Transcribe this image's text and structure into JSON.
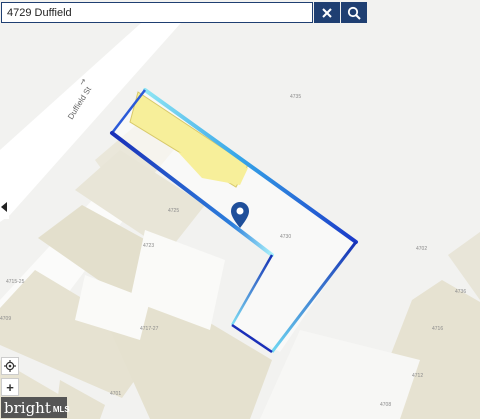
{
  "search": {
    "value": "4729 Duffield"
  },
  "map": {
    "street_name": "Duffield St",
    "parcel_labels": [
      "4735",
      "4725",
      "4730",
      "4723",
      "4715-25",
      "4717-27",
      "4701",
      "4736",
      "4716",
      "4712",
      "4708",
      "4709",
      "4702"
    ]
  },
  "logo": {
    "text": "brightMLS"
  }
}
